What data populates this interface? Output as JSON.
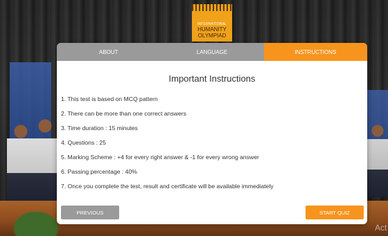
{
  "logo": {
    "line1": "INTERNATIONAL",
    "line2": "HUMANITY",
    "line3": "OLYMPIAD"
  },
  "tabs": [
    {
      "label": "ABOUT",
      "active": false
    },
    {
      "label": "LANGUAGE",
      "active": false
    },
    {
      "label": "INSTRUCTIONS",
      "active": true
    }
  ],
  "main": {
    "title": "Important Instructions",
    "instructions": [
      "1. This test is based on MCQ pattern",
      "2. There can be more than one correct answers",
      "3. Time duration : 15 minutes",
      "4. Questions : 25",
      "5. Marking Scheme : +4 for every right answer & -1 for every wrong answer",
      "6. Passing percentage : 40%",
      "7. Once you complete the test, result and certificate will be available immediately"
    ]
  },
  "footer": {
    "previous_label": "PREVIOUS",
    "start_label": "START QUIZ"
  },
  "watermark": "Act",
  "colors": {
    "accent": "#f7941d",
    "inactive": "#9a9a9a",
    "text": "#333333"
  }
}
